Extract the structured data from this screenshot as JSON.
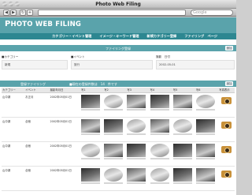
{
  "window": {
    "title": "Photo Web Filing",
    "search_placeholder": "Google"
  },
  "app": {
    "logo_prefix": "P",
    "logo_text": "HOTO WEB FILING"
  },
  "menu": [
    "カテゴリー・イベント管理",
    "イメージ・キーワード管理",
    "新規カテゴリー登録",
    "ファイリング　ページ"
  ],
  "filter_section": {
    "title": "ファイリング登録",
    "button": "追加"
  },
  "filter": {
    "category_label": "■カテゴリー",
    "category_value": "新規",
    "event_label": "■イベント",
    "event_value": "旅行",
    "date_label": "撮影　日付",
    "date_value": "2002-05-01"
  },
  "list_section": {
    "left": "登録ファイリング",
    "middle": "■現在の登録件数は　14　件です",
    "button": "追加"
  },
  "table": {
    "headers": [
      "カテゴリー",
      "イベント",
      "撮影年月日",
      "写1",
      "写2",
      "写3",
      "写4",
      "写5",
      "写6",
      "写真表示"
    ],
    "rows": [
      {
        "category": "山中湖",
        "event": "お正月",
        "date": "2002年05月01日"
      },
      {
        "category": "山中湖",
        "event": "合宿",
        "date": "2002年05月01日"
      },
      {
        "category": "山中湖",
        "event": "合宿",
        "date": "2002年05月01日"
      },
      {
        "category": "山中湖",
        "event": "合宿",
        "date": "2002年05月01日"
      }
    ]
  }
}
